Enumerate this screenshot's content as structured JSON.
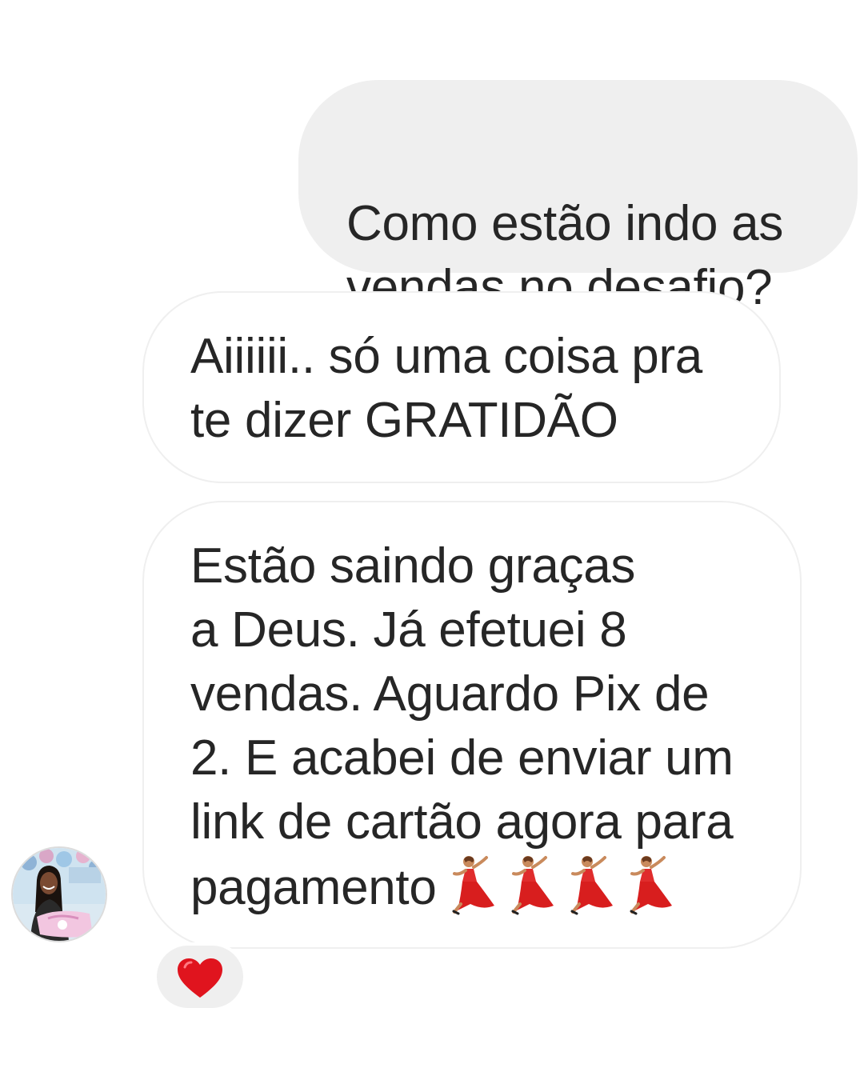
{
  "messages": [
    {
      "sender": "me",
      "text": "Como estão indo as\nvendas no desafio?"
    },
    {
      "sender": "contact",
      "text": "Aiiiiii.. só uma coisa pra\nte dizer GRATIDÃO"
    },
    {
      "sender": "contact",
      "text": "Estão saindo graças\na Deus. Já efetuei 8\nvendas. Aguardo Pix de\n2. E acabei de enviar um\nlink de cartão agora para\npagamento",
      "emojis": [
        "woman-dancing-icon",
        "woman-dancing-icon",
        "woman-dancing-icon",
        "woman-dancing-icon"
      ]
    }
  ],
  "reaction": {
    "icon": "red-heart-icon",
    "color": "#e0141e"
  },
  "avatar": {
    "icon": "contact-avatar"
  },
  "colors": {
    "sent_bubble": "#efefef",
    "received_border": "#efefef",
    "text": "#262626"
  }
}
